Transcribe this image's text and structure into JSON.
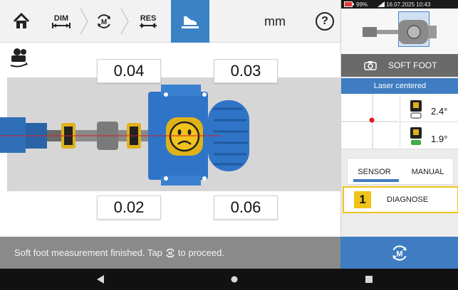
{
  "toolbar": {
    "dim_label": "DIM",
    "res_label": "RES",
    "unit": "mm",
    "help": "?"
  },
  "values": {
    "top_left": "0.04",
    "top_right": "0.03",
    "bottom_left": "0.02",
    "bottom_right": "0.06"
  },
  "status": {
    "message_before": "Soft foot measurement finished. Tap",
    "message_after": "to proceed."
  },
  "system": {
    "battery": "99%",
    "datetime": "16.07.2025  10:43"
  },
  "right_panel": {
    "mode_title": "SOFT FOOT",
    "laser_status": "Laser centered",
    "angle_1": "2.4°",
    "angle_2": "1.9°",
    "tabs": [
      "SENSOR",
      "MANUAL"
    ],
    "diagnose_number": "1",
    "diagnose_label": "DIAGNOSE"
  },
  "colors": {
    "accent_blue": "#3f7cc1",
    "highlight_yellow": "#f0c419",
    "motor_blue": "#2f74c7"
  }
}
